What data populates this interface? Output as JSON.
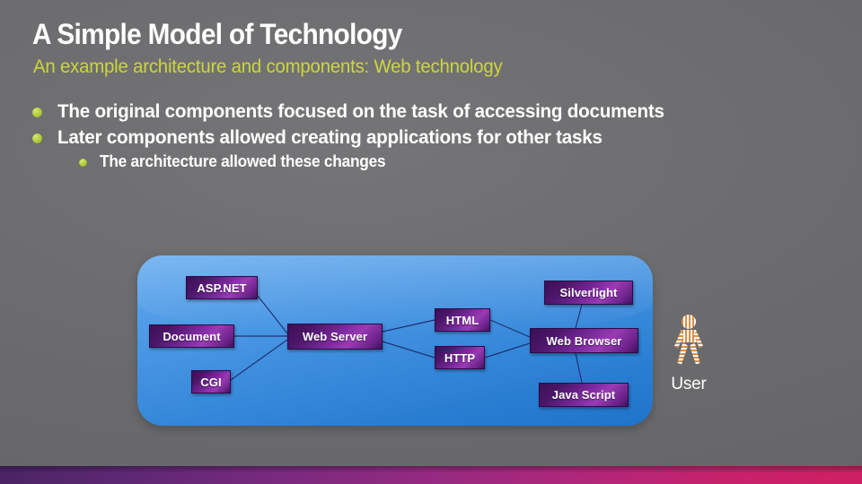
{
  "slide": {
    "title": "A Simple Model of Technology",
    "subtitle": "An example architecture and components: Web technology",
    "colors": {
      "background": "#6e6e70",
      "title_text": "#ffffff",
      "subtitle_text": "#cdd63b",
      "bullet_dot": "#b5cf45",
      "panel_blue": "#3f8fdf",
      "node_purple": "#7c2a9e",
      "edge_line": "#1b2a6b",
      "bottom_bar_left": "#4a2464",
      "bottom_bar_right": "#cf1f63",
      "user_figure": "#d98f4a"
    }
  },
  "bullets": [
    {
      "level": 1,
      "text": "The original components focused on the task of accessing documents"
    },
    {
      "level": 1,
      "text": "Later components allowed creating applications for other tasks"
    },
    {
      "level": 2,
      "text": "The architecture allowed these changes"
    }
  ],
  "diagram": {
    "type": "node-link",
    "nodes": [
      {
        "id": "aspnet",
        "label": "ASP.NET"
      },
      {
        "id": "document",
        "label": "Document"
      },
      {
        "id": "cgi",
        "label": "CGI"
      },
      {
        "id": "webserver",
        "label": "Web Server"
      },
      {
        "id": "html",
        "label": "HTML"
      },
      {
        "id": "http",
        "label": "HTTP"
      },
      {
        "id": "silverlight",
        "label": "Silverlight"
      },
      {
        "id": "webbrowser",
        "label": "Web Browser"
      },
      {
        "id": "javascript",
        "label": "Java Script"
      }
    ],
    "edges": [
      {
        "from": "aspnet",
        "to": "webserver"
      },
      {
        "from": "document",
        "to": "webserver"
      },
      {
        "from": "cgi",
        "to": "webserver"
      },
      {
        "from": "webserver",
        "to": "html"
      },
      {
        "from": "webserver",
        "to": "http"
      },
      {
        "from": "html",
        "to": "webbrowser"
      },
      {
        "from": "http",
        "to": "webbrowser"
      },
      {
        "from": "silverlight",
        "to": "webbrowser"
      },
      {
        "from": "webbrowser",
        "to": "javascript"
      }
    ]
  },
  "user": {
    "label": "User",
    "icon": "person-figure-icon"
  }
}
